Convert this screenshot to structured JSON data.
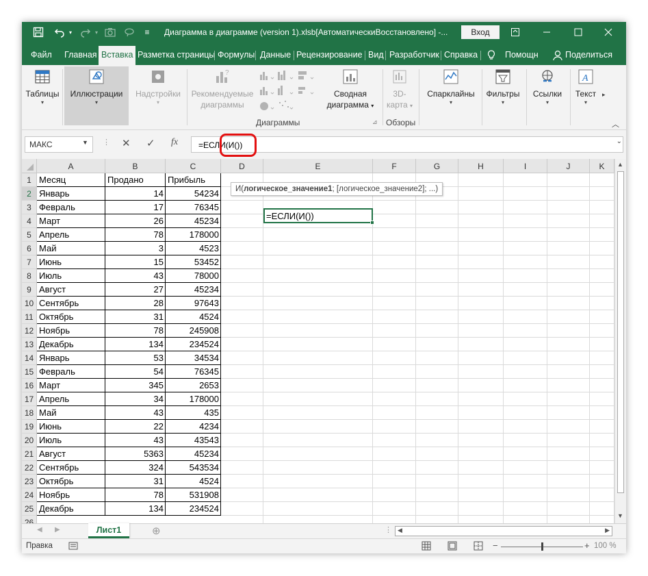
{
  "window": {
    "title": "Диаграмма в диаграмме (version 1).xlsb[АвтоматическиВосстановлено]  -...",
    "signin": "Вход",
    "buttons": {
      "ribbon_display": "⊡",
      "minimize": "—",
      "maximize": "☐",
      "close": "✕"
    },
    "quick_access": {
      "save_icon": "save-icon",
      "undo_icon": "undo-icon",
      "redo_icon": "redo-icon",
      "camera_icon": "camera-icon",
      "more": "≡"
    }
  },
  "tabs": [
    {
      "label": "Файл"
    },
    {
      "label": "Главная"
    },
    {
      "label": "Вставка",
      "active": true
    },
    {
      "label": "Разметка страницы"
    },
    {
      "label": "Формулы"
    },
    {
      "label": "Данные"
    },
    {
      "label": "Рецензирование"
    },
    {
      "label": "Вид"
    },
    {
      "label": "Разработчик"
    },
    {
      "label": "Справка"
    },
    {
      "label": "Помощн"
    },
    {
      "label": "Поделиться"
    }
  ],
  "ribbon": {
    "tables": "Таблицы",
    "illustrations": "Иллюстрации",
    "addins": "Надстройки",
    "recommended_charts_1": "Рекомендуемые",
    "recommended_charts_2": "диаграммы",
    "pivot_chart_1": "Сводная",
    "pivot_chart_2": "диаграмма",
    "map_3d_1": "3D-",
    "map_3d_2": "карта",
    "sparklines": "Спарклайны",
    "filters": "Фильтры",
    "links": "Ссылки",
    "text": "Текст",
    "group_charts": "Диаграммы",
    "group_tours": "Обзоры"
  },
  "formula_bar": {
    "name_box": "МАКС",
    "cancel": "✕",
    "enter": "✓",
    "fx": "fx",
    "formula": "=ЕСЛИ(И())"
  },
  "tooltip": {
    "func": "И(",
    "arg1": "логическое_значение1",
    "rest": "; [логическое_значение2]; ...)"
  },
  "columns": [
    "A",
    "B",
    "C",
    "D",
    "E",
    "F",
    "G",
    "H",
    "I",
    "J",
    "K"
  ],
  "table": {
    "headers": [
      "Месяц",
      "Продано",
      "Прибыль"
    ],
    "rows": [
      [
        "Январь",
        "14",
        "54234"
      ],
      [
        "Февраль",
        "17",
        "76345"
      ],
      [
        "Март",
        "26",
        "45234"
      ],
      [
        "Апрель",
        "78",
        "178000"
      ],
      [
        "Май",
        "3",
        "4523"
      ],
      [
        "Июнь",
        "15",
        "53452"
      ],
      [
        "Июль",
        "43",
        "78000"
      ],
      [
        "Август",
        "27",
        "45234"
      ],
      [
        "Сентябрь",
        "28",
        "97643"
      ],
      [
        "Октябрь",
        "31",
        "4524"
      ],
      [
        "Ноябрь",
        "78",
        "245908"
      ],
      [
        "Декабрь",
        "134",
        "234524"
      ],
      [
        "Январь",
        "53",
        "34534"
      ],
      [
        "Февраль",
        "54",
        "76345"
      ],
      [
        "Март",
        "345",
        "2653"
      ],
      [
        "Апрель",
        "34",
        "178000"
      ],
      [
        "Май",
        "43",
        "435"
      ],
      [
        "Июнь",
        "22",
        "4234"
      ],
      [
        "Июль",
        "43",
        "43543"
      ],
      [
        "Август",
        "5363",
        "45234"
      ],
      [
        "Сентябрь",
        "324",
        "543534"
      ],
      [
        "Октябрь",
        "31",
        "4524"
      ],
      [
        "Ноябрь",
        "78",
        "531908"
      ],
      [
        "Декабрь",
        "134",
        "234524"
      ]
    ]
  },
  "active_cell_text": "=ЕСЛИ(И())",
  "sheet_tab": "Лист1",
  "add_sheet": "⊕",
  "status": {
    "mode": "Правка",
    "zoom": "100 %"
  },
  "colors": {
    "accent": "#217346",
    "highlight_ring": "#e31010"
  }
}
